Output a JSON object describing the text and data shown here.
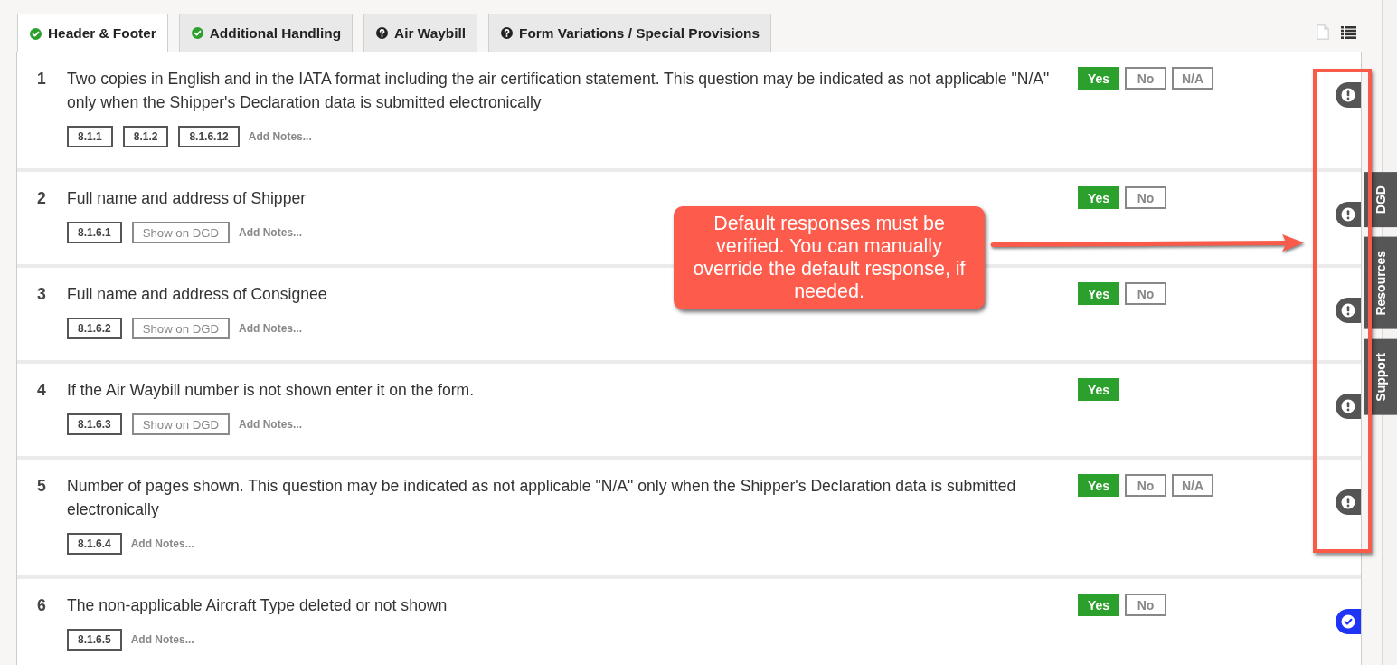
{
  "tabs": [
    {
      "label": "Header & Footer",
      "complete": true,
      "selected": true
    },
    {
      "label": "Additional Handling",
      "complete": true,
      "selected": false
    },
    {
      "label": "Air Waybill",
      "complete": false,
      "selected": false
    },
    {
      "label": "Form Variations / Special Provisions",
      "complete": false,
      "selected": false
    }
  ],
  "questions": [
    {
      "number": "1",
      "text": "Two copies in English and in the IATA format including the air certification statement. This question may be indicated as not applicable \"N/A\" only when the Shipper's Declaration data is submitted electronically",
      "references": [
        "8.1.1",
        "8.1.2",
        "8.1.6.12"
      ],
      "notes_link": "Add Notes...",
      "answers": [
        {
          "label": "Yes",
          "selected": true
        },
        {
          "label": "No",
          "selected": false
        },
        {
          "label": "N/A",
          "selected": false
        }
      ],
      "verified": false
    },
    {
      "number": "2",
      "text": "Full name and address of Shipper",
      "references": [
        "8.1.6.1"
      ],
      "dgd_button": "Show on DGD",
      "notes_link": "Add Notes...",
      "answers": [
        {
          "label": "Yes",
          "selected": true
        },
        {
          "label": "No",
          "selected": false
        }
      ],
      "verified": false
    },
    {
      "number": "3",
      "text": "Full name and address of Consignee",
      "references": [
        "8.1.6.2"
      ],
      "dgd_button": "Show on DGD",
      "notes_link": "Add Notes...",
      "answers": [
        {
          "label": "Yes",
          "selected": true
        },
        {
          "label": "No",
          "selected": false
        }
      ],
      "verified": false
    },
    {
      "number": "4",
      "text": "If the Air Waybill number is not shown enter it on the form.",
      "references": [
        "8.1.6.3"
      ],
      "dgd_button": "Show on DGD",
      "notes_link": "Add Notes...",
      "answers": [
        {
          "label": "Yes",
          "selected": true
        }
      ],
      "verified": false
    },
    {
      "number": "5",
      "text": "Number of pages shown. This question may be indicated as not applicable \"N/A\" only when the Shipper's Declaration data is submitted electronically",
      "references": [
        "8.1.6.4"
      ],
      "notes_link": "Add Notes...",
      "answers": [
        {
          "label": "Yes",
          "selected": true
        },
        {
          "label": "No",
          "selected": false
        },
        {
          "label": "N/A",
          "selected": false
        }
      ],
      "verified": false
    },
    {
      "number": "6",
      "text": "The non-applicable Aircraft Type deleted or not shown",
      "references": [
        "8.1.6.5"
      ],
      "notes_link": "Add Notes...",
      "answers": [
        {
          "label": "Yes",
          "selected": true
        },
        {
          "label": "No",
          "selected": false
        }
      ],
      "verified": true
    }
  ],
  "side_tabs": [
    "DGD",
    "Resources",
    "Support"
  ],
  "callout": {
    "text": "Default responses must be verified. You can manually override the default response, if needed."
  }
}
